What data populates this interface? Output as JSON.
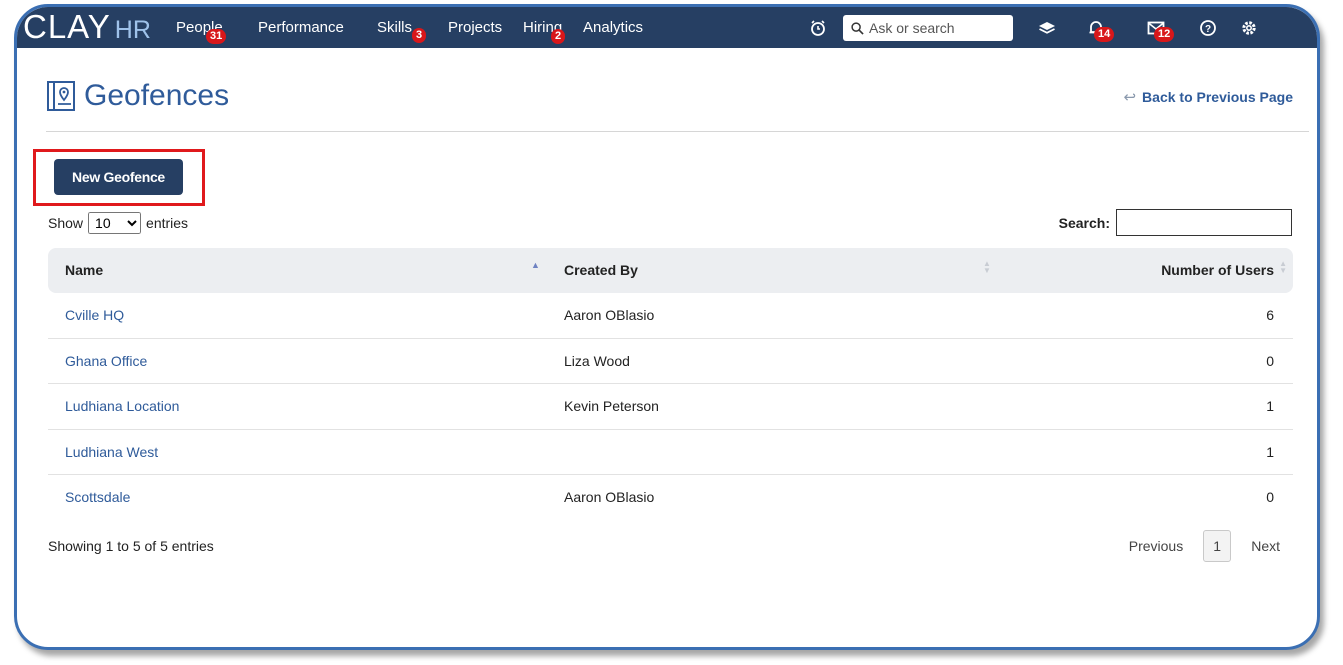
{
  "app": {
    "logo_main": "CLAY",
    "logo_sub": "HR"
  },
  "nav": {
    "items": [
      {
        "label": "People",
        "badge": "31"
      },
      {
        "label": "Performance",
        "badge": ""
      },
      {
        "label": "Skills",
        "badge": "3"
      },
      {
        "label": "Projects",
        "badge": ""
      },
      {
        "label": "Hiring",
        "badge": "2"
      },
      {
        "label": "Analytics",
        "badge": ""
      }
    ],
    "search_placeholder": "Ask or search",
    "notifications_badge": "14",
    "messages_badge": "12"
  },
  "page": {
    "title": "Geofences",
    "back_link": "Back to Previous Page",
    "new_button": "New Geofence",
    "show_label": "Show",
    "entries_label": "entries",
    "entries_value": "10",
    "search_label": "Search:"
  },
  "table": {
    "headers": {
      "name": "Name",
      "created_by": "Created By",
      "users": "Number of Users"
    },
    "rows": [
      {
        "name": "Cville HQ",
        "created_by": "Aaron OBlasio",
        "users": "6"
      },
      {
        "name": "Ghana Office",
        "created_by": "Liza Wood",
        "users": "0"
      },
      {
        "name": "Ludhiana Location",
        "created_by": "Kevin Peterson",
        "users": "1"
      },
      {
        "name": "Ludhiana West",
        "created_by": "",
        "users": "1"
      },
      {
        "name": "Scottsdale",
        "created_by": "Aaron OBlasio",
        "users": "0"
      }
    ]
  },
  "footer": {
    "info": "Showing 1 to 5 of 5 entries",
    "previous": "Previous",
    "page": "1",
    "next": "Next"
  },
  "colors": {
    "nav_bg": "#263f63",
    "accent_link": "#2f5b9a",
    "badge": "#d8171a",
    "highlight": "#e0191c"
  }
}
